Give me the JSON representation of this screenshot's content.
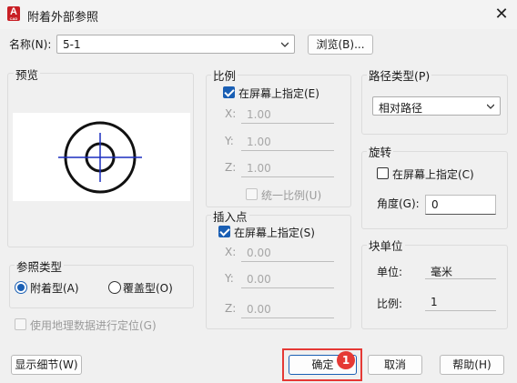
{
  "window": {
    "title": "附着外部参照",
    "app_icon_letter": "A",
    "app_icon_sub": "CAD"
  },
  "name_field": {
    "label": "名称(N):",
    "value": "5-1",
    "browse_label": "浏览(B)..."
  },
  "preview": {
    "title": "预览"
  },
  "scale": {
    "title": "比例",
    "specify_label": "在屏幕上指定(E)",
    "specify_checked": true,
    "x_label": "X:",
    "x_value": "1.00",
    "y_label": "Y:",
    "y_value": "1.00",
    "z_label": "Z:",
    "z_value": "1.00",
    "uniform_label": "统一比例(U)"
  },
  "insert_point": {
    "title": "插入点",
    "specify_label": "在屏幕上指定(S)",
    "specify_checked": true,
    "x_label": "X:",
    "x_value": "0.00",
    "y_label": "Y:",
    "y_value": "0.00",
    "z_label": "Z:",
    "z_value": "0.00"
  },
  "path_type": {
    "title": "路径类型(P)",
    "value": "相对路径"
  },
  "rotation": {
    "title": "旋转",
    "specify_label": "在屏幕上指定(C)",
    "angle_label": "角度(G):",
    "angle_value": "0"
  },
  "block_unit": {
    "title": "块单位",
    "unit_label": "单位:",
    "unit_value": "毫米",
    "ratio_label": "比例:",
    "ratio_value": "1"
  },
  "reference_type": {
    "title": "参照类型",
    "attach_label": "附着型(A)",
    "overlay_label": "覆盖型(O)",
    "selected": "attach"
  },
  "geo": {
    "label": "使用地理数据进行定位(G)"
  },
  "buttons": {
    "details": "显示细节(W)",
    "ok": "确定",
    "cancel": "取消",
    "help": "帮助(H)"
  },
  "annotation": {
    "badge": "1",
    "color": "#e53935"
  },
  "colors": {
    "accent": "#1a5fb4",
    "preview_cross": "#1a2dbf"
  }
}
